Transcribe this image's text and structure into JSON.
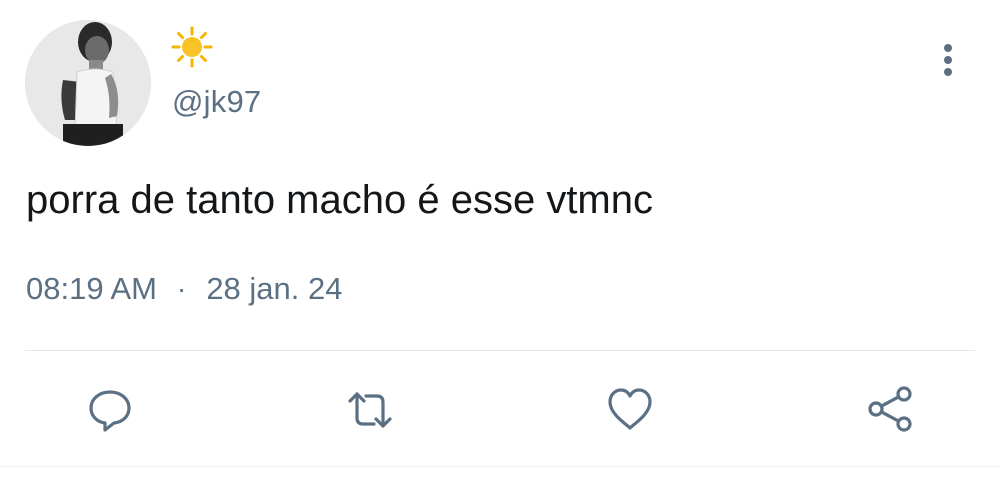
{
  "tweet": {
    "display_name_icon": "sun-emoji",
    "handle": "@jk97",
    "text": "porra de tanto macho é esse vtmnc",
    "time": "08:19 AM",
    "separator": "·",
    "date": "28 jan. 24"
  },
  "actions": {
    "reply_icon": "speech-bubble-icon",
    "retweet_icon": "retweet-icon",
    "like_icon": "heart-icon",
    "share_icon": "share-icon"
  },
  "colors": {
    "secondary_text": "#5b7083",
    "primary_text": "#14171a",
    "divider": "#e1e8ed",
    "sun": "#f7c428"
  }
}
